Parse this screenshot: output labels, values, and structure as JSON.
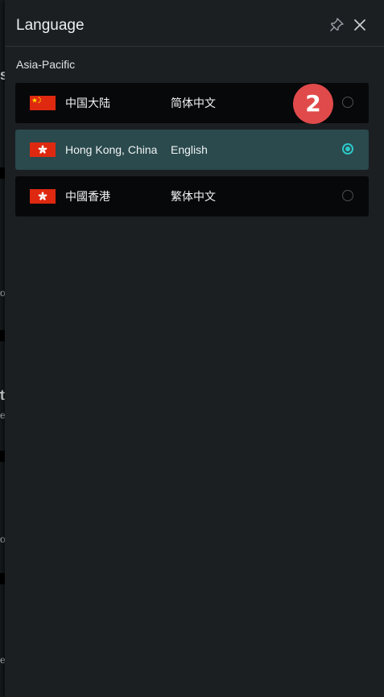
{
  "panel": {
    "title": "Language",
    "section_label": "Asia-Pacific",
    "pin_icon": "pin-icon",
    "close_icon": "close-icon"
  },
  "rows": [
    {
      "region": "中国大陆",
      "language": "简体中文",
      "flag": "china-flag-icon",
      "selected": false
    },
    {
      "region": "Hong Kong, China",
      "language": "English",
      "flag": "hong-kong-flag-icon",
      "selected": true
    },
    {
      "region": "中國香港",
      "language": "繁体中文",
      "flag": "hong-kong-flag-icon",
      "selected": false
    }
  ],
  "step_badge": "2",
  "background_fragments": [
    "s",
    "o",
    "t",
    "e",
    "o",
    "e"
  ],
  "colors": {
    "accent": "#2ec8c8",
    "selected_row": "#2a4a4d",
    "badge": "#e04a4a",
    "flag_red": "#de2910",
    "flag_yellow": "#ffde00"
  }
}
